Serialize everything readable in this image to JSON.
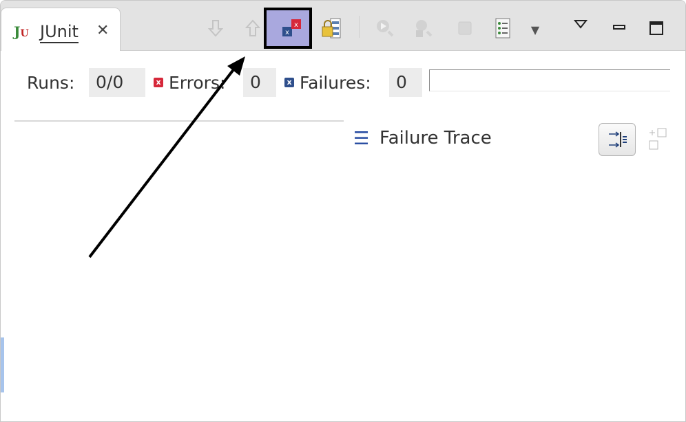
{
  "tab": {
    "icon_text": "J",
    "icon_sub": "U",
    "label": "JUnit",
    "close_glyph": "✕"
  },
  "toolbar": {
    "icons": [
      "next-failure-icon",
      "previous-failure-icon",
      "show-failures-only-icon",
      "scroll-lock-icon",
      "rerun-test-icon",
      "rerun-failed-first-icon",
      "stop-icon",
      "test-run-history-icon",
      "history-dropdown-icon",
      "view-menu-icon",
      "minimize-icon",
      "maximize-icon"
    ]
  },
  "counters": {
    "runs_label": "Runs:",
    "runs_value": "0/0",
    "errors_label": "Errors:",
    "errors_value": "0",
    "failures_label": "Failures:",
    "failures_value": "0"
  },
  "trace": {
    "title": "Failure Trace"
  },
  "colors": {
    "highlight_bg": "#a9a8de",
    "error_mark": "#d6283a",
    "failure_mark": "#2f4f8c",
    "tab_bar": "#e3e3e3"
  }
}
